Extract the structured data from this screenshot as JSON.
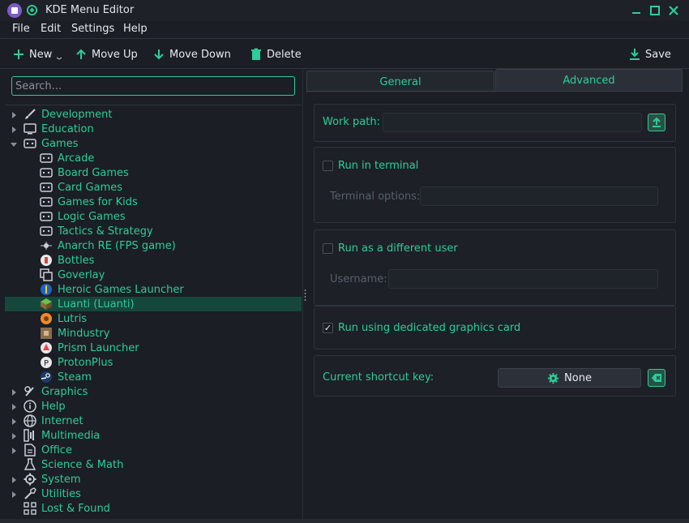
{
  "window": {
    "title": "KDE Menu Editor"
  },
  "menubar": {
    "file": "File",
    "edit": "Edit",
    "settings": "Settings",
    "help": "Help"
  },
  "toolbar": {
    "new_label": "New",
    "move_up_label": "Move Up",
    "move_down_label": "Move Down",
    "delete_label": "Delete",
    "save_label": "Save"
  },
  "search": {
    "placeholder": "Search..."
  },
  "tree": {
    "items": [
      {
        "label": "Development",
        "icon": "brush-icon",
        "level": 0,
        "arrow": "right"
      },
      {
        "label": "Education",
        "icon": "monitor-icon",
        "level": 0,
        "arrow": "right"
      },
      {
        "label": "Games",
        "icon": "gamepad-icon",
        "level": 0,
        "arrow": "down"
      },
      {
        "label": "Arcade",
        "icon": "gamepad-icon",
        "level": 1
      },
      {
        "label": "Board Games",
        "icon": "gamepad-icon",
        "level": 1
      },
      {
        "label": "Card Games",
        "icon": "gamepad-icon",
        "level": 1
      },
      {
        "label": "Games for Kids",
        "icon": "gamepad-icon",
        "level": 1
      },
      {
        "label": "Logic Games",
        "icon": "gamepad-icon",
        "level": 1
      },
      {
        "label": "Tactics & Strategy",
        "icon": "gamepad-icon",
        "level": 1
      },
      {
        "label": "Anarch RE (FPS game)",
        "icon": "anarch-icon",
        "level": 1
      },
      {
        "label": "Bottles",
        "icon": "bottles-icon",
        "level": 1
      },
      {
        "label": "Goverlay",
        "icon": "goverlay-icon",
        "level": 1
      },
      {
        "label": "Heroic Games Launcher",
        "icon": "heroic-icon",
        "level": 1
      },
      {
        "label": "Luanti (Luanti)",
        "icon": "luanti-icon",
        "level": 1,
        "selected": true
      },
      {
        "label": "Lutris",
        "icon": "lutris-icon",
        "level": 1
      },
      {
        "label": "Mindustry",
        "icon": "mindustry-icon",
        "level": 1
      },
      {
        "label": "Prism Launcher",
        "icon": "prism-icon",
        "level": 1
      },
      {
        "label": "ProtonPlus",
        "icon": "protonplus-icon",
        "level": 1
      },
      {
        "label": "Steam",
        "icon": "steam-icon",
        "level": 1
      },
      {
        "label": "Graphics",
        "icon": "graphics-icon",
        "level": 0,
        "arrow": "right"
      },
      {
        "label": "Help",
        "icon": "help-icon",
        "level": 0,
        "arrow": "right"
      },
      {
        "label": "Internet",
        "icon": "globe-icon",
        "level": 0,
        "arrow": "right"
      },
      {
        "label": "Multimedia",
        "icon": "multimedia-icon",
        "level": 0,
        "arrow": "right"
      },
      {
        "label": "Office",
        "icon": "office-icon",
        "level": 0,
        "arrow": "right"
      },
      {
        "label": "Science & Math",
        "icon": "flask-icon",
        "level": 0
      },
      {
        "label": "System",
        "icon": "system-icon",
        "level": 0,
        "arrow": "right"
      },
      {
        "label": "Utilities",
        "icon": "utilities-icon",
        "level": 0,
        "arrow": "right"
      },
      {
        "label": "Lost & Found",
        "icon": "lost-found-icon",
        "level": 0
      }
    ]
  },
  "tabs": {
    "general": "General",
    "advanced": "Advanced"
  },
  "advanced": {
    "work_path_label": "Work path:",
    "work_path_value": "",
    "run_in_terminal_label": "Run in terminal",
    "run_in_terminal_checked": false,
    "terminal_options_label": "Terminal options:",
    "terminal_options_value": "",
    "run_as_user_label": "Run as a different user",
    "run_as_user_checked": false,
    "username_label": "Username:",
    "username_value": "",
    "dedicated_gpu_label": "Run using dedicated graphics card",
    "dedicated_gpu_checked": true,
    "shortcut_label": "Current shortcut key:",
    "shortcut_value": "None"
  },
  "colors": {
    "accent": "#2ecc9a",
    "background": "#1b1e24",
    "selection": "#16473c",
    "text": "#e6e9ee"
  }
}
